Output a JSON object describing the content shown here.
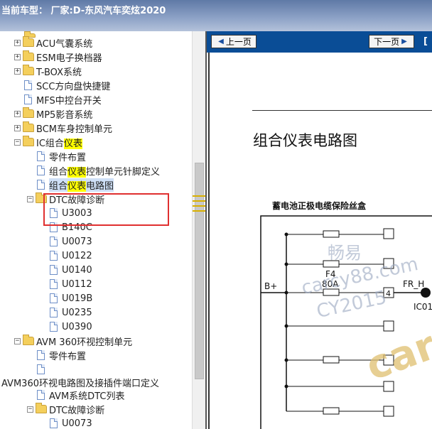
{
  "window": {
    "title": "当前车型：  厂家:D-东风汽车奕炫2020"
  },
  "tree": {
    "items": [
      {
        "type": "folder",
        "exp": "+",
        "label": "ACU气囊系统"
      },
      {
        "type": "folder",
        "exp": "+",
        "label": "ESM电子换档器"
      },
      {
        "type": "folder",
        "exp": "+",
        "label": "T-BOX系统"
      },
      {
        "type": "doc",
        "label": "SCC方向盘快捷键"
      },
      {
        "type": "doc",
        "label": "MFS中控台开关"
      },
      {
        "type": "folder",
        "exp": "+",
        "label": "MP5影音系统"
      },
      {
        "type": "folder",
        "exp": "+",
        "label": "BCM车身控制单元"
      },
      {
        "type": "folder",
        "exp": "-",
        "label_a": "IC组合",
        "label_hl": "仪表"
      },
      {
        "type": "doc",
        "label": "零件布置"
      },
      {
        "type": "doc",
        "label_a": "组合",
        "label_hl": "仪表",
        "label_b": "控制单元针脚定义"
      },
      {
        "type": "doc",
        "label_a": "组合",
        "label_hl": "仪表",
        "label_b": "电路图"
      },
      {
        "type": "folder",
        "exp": "-",
        "label": "DTC故障诊断"
      },
      {
        "type": "doc",
        "label": "U3003"
      },
      {
        "type": "doc",
        "label": "B140C"
      },
      {
        "type": "doc",
        "label": "U0073"
      },
      {
        "type": "doc",
        "label": "U0122"
      },
      {
        "type": "doc",
        "label": "U0140"
      },
      {
        "type": "doc",
        "label": "U0112"
      },
      {
        "type": "doc",
        "label": "U019B"
      },
      {
        "type": "doc",
        "label": "U0235"
      },
      {
        "type": "doc",
        "label": "U0390"
      },
      {
        "type": "folder",
        "exp": "-",
        "label": "AVM 360环视控制单元"
      },
      {
        "type": "doc",
        "label": "零件布置"
      },
      {
        "type": "doc",
        "label": ""
      },
      {
        "type": "text",
        "label": "AVM360环视电路图及接插件端口定义"
      },
      {
        "type": "doc",
        "label": "AVM系统DTC列表"
      },
      {
        "type": "folder",
        "exp": "-",
        "label": "DTC故障诊断"
      },
      {
        "type": "doc",
        "label": "U0073"
      }
    ]
  },
  "nav": {
    "prev": "上一页",
    "next": "下一页",
    "edge": "["
  },
  "document": {
    "title": "组合仪表电路图",
    "box_title": "蓄电池正极电缆保险丝盒",
    "fuse_name": "F4",
    "fuse_rating": "80A",
    "bplus": "B+",
    "pin": "4",
    "wire": "FR_H",
    "connector": "IC01"
  },
  "watermark": {
    "w1": "畅易",
    "w2": "carcy88.com",
    "w3": "CY2015",
    "w4": "car"
  }
}
